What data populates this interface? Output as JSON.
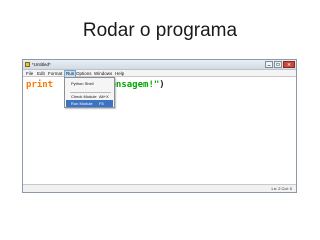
{
  "slide": {
    "title": "Rodar o programa"
  },
  "window": {
    "title": "*Untitled*",
    "menu": [
      "File",
      "Edit",
      "Format",
      "Run",
      "Options",
      "Windows",
      "Help"
    ],
    "active_menu": "Run"
  },
  "editor": {
    "keyword": "print",
    "string_visible": "mensagem!\"",
    "close_paren": ")"
  },
  "run_menu": {
    "items": [
      {
        "label": "Python Shell",
        "shortcut": ""
      },
      {
        "label": "Check Module",
        "shortcut": "Alt+X"
      },
      {
        "label": "Run Module",
        "shortcut": "F5"
      }
    ],
    "highlighted_index": 2
  },
  "status": {
    "position": "Ln: 2 Col: 0"
  },
  "colors": {
    "keyword": "#ff7700",
    "string": "#00aa00",
    "highlight": "#3d73c4"
  }
}
